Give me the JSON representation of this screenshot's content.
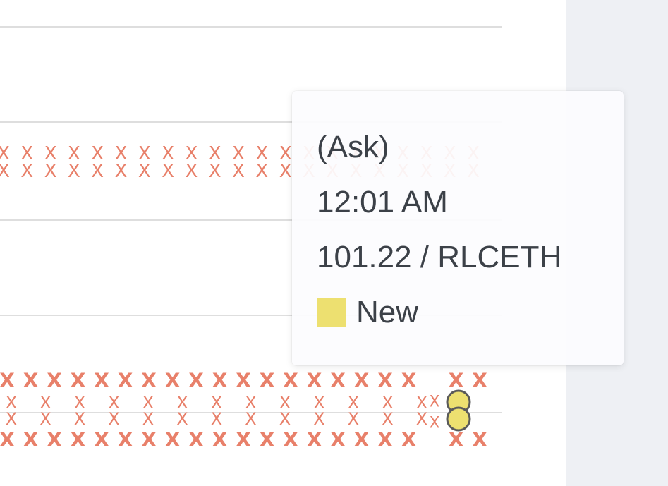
{
  "colors": {
    "ask_marker": "#e8806a",
    "new_order": "#ede070",
    "new_order_stroke": "#5a5a5a",
    "gridline": "#dedede",
    "panel_bg": "#eef0f4"
  },
  "chart": {
    "marker_symbol": "X",
    "marker_icon": "x-mark-icon",
    "new_order_icon": "circle-marker-icon"
  },
  "tooltip": {
    "side": "(Ask)",
    "time": "12:01 AM",
    "price": "101.22 / RLCETH",
    "legend_label": "New",
    "legend_color": "#ede070"
  }
}
